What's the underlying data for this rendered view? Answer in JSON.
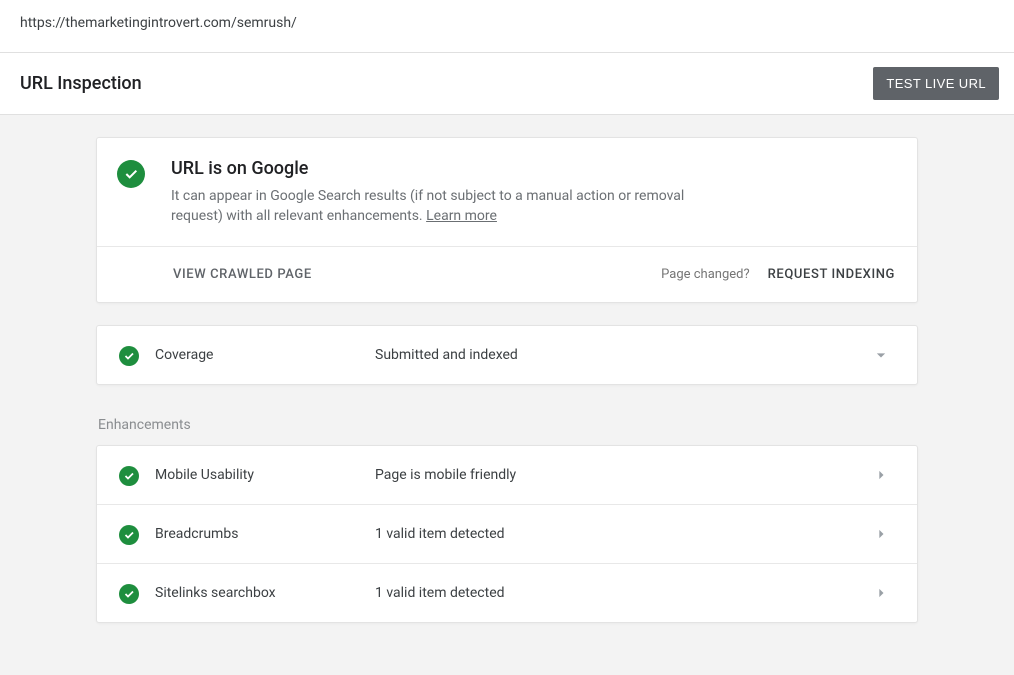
{
  "url_bar": "https://themarketingintrovert.com/semrush/",
  "page_title": "URL Inspection",
  "test_live_label": "TEST LIVE URL",
  "status": {
    "title": "URL is on Google",
    "description_prefix": "It can appear in Google Search results (if not subject to a manual action or removal request) with all relevant enhancements. ",
    "learn_more": "Learn more",
    "view_crawled": "VIEW CRAWLED PAGE",
    "page_changed": "Page changed?",
    "request_indexing": "REQUEST INDEXING"
  },
  "coverage": {
    "label": "Coverage",
    "value": "Submitted and indexed"
  },
  "enhancements_label": "Enhancements",
  "enhancements": [
    {
      "label": "Mobile Usability",
      "value": "Page is mobile friendly"
    },
    {
      "label": "Breadcrumbs",
      "value": "1 valid item detected"
    },
    {
      "label": "Sitelinks searchbox",
      "value": "1 valid item detected"
    }
  ]
}
